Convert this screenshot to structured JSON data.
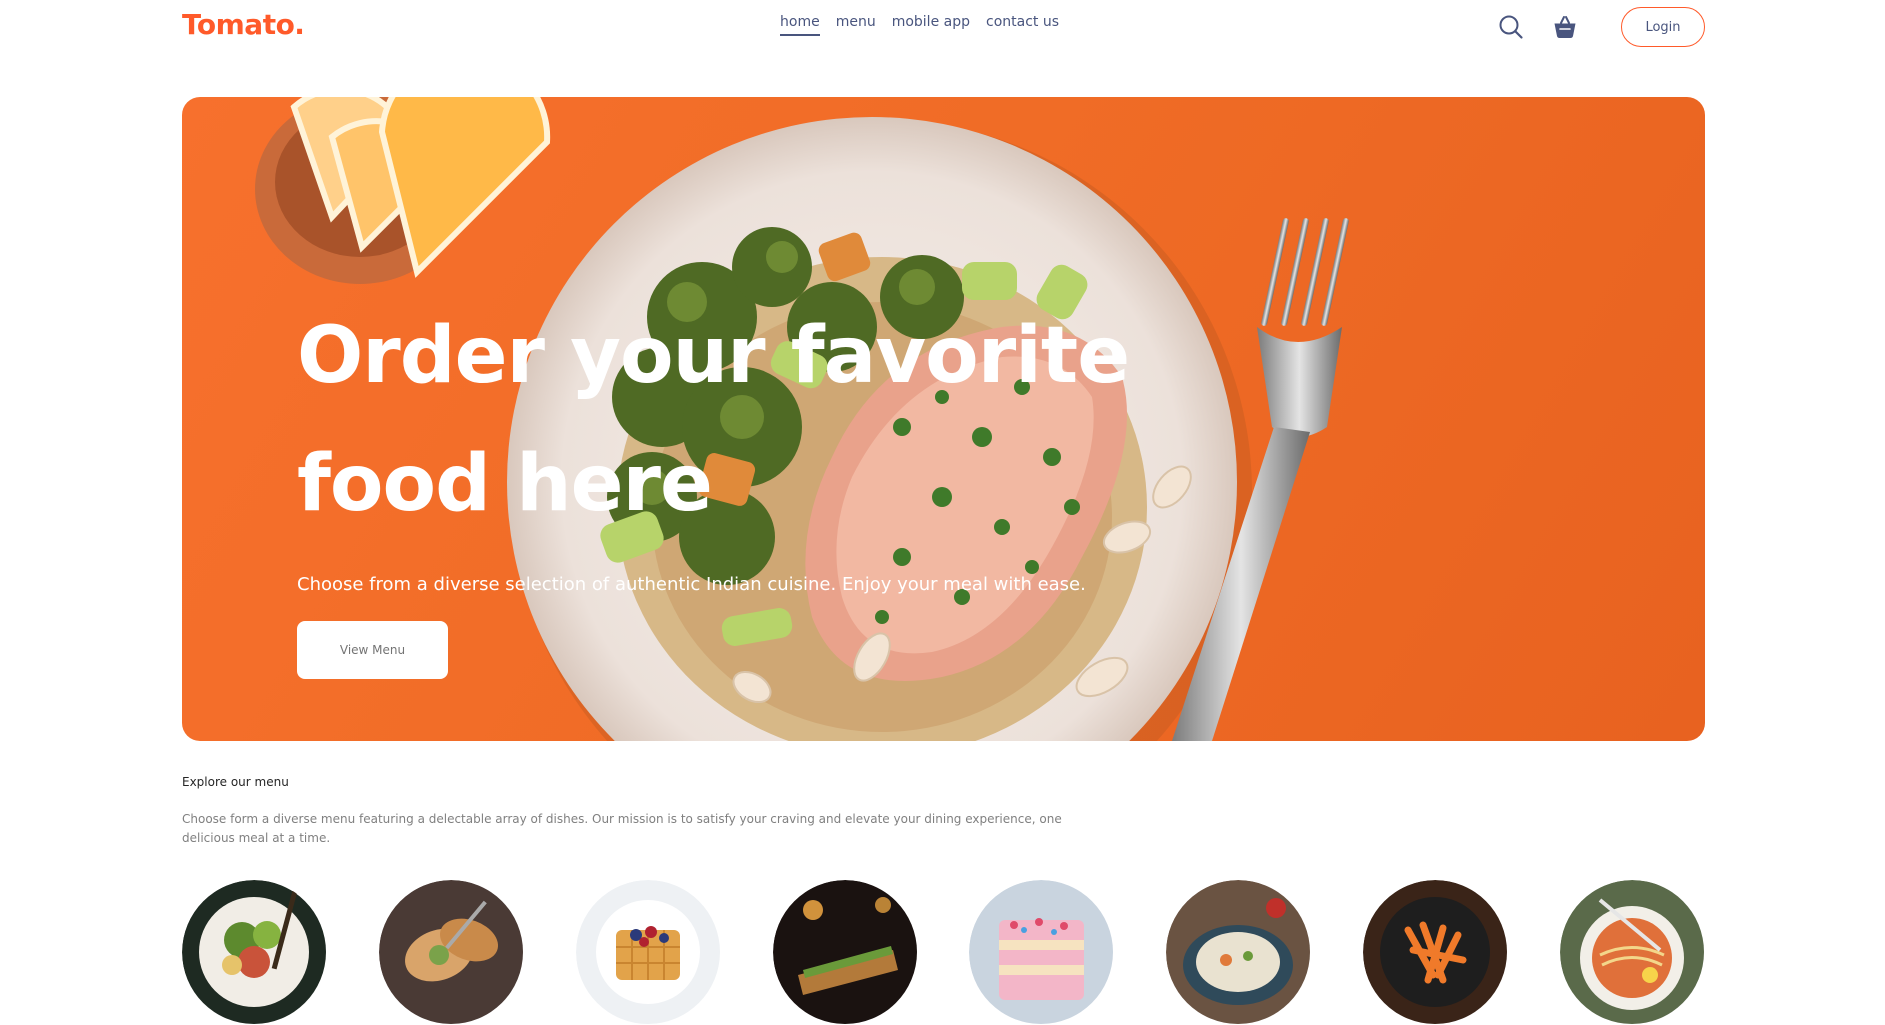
{
  "brand": {
    "name": "Tomato.",
    "color": "#ff5a2a"
  },
  "nav": {
    "links": [
      {
        "label": "home",
        "active": true
      },
      {
        "label": "menu",
        "active": false
      },
      {
        "label": "mobile app",
        "active": false
      },
      {
        "label": "contact us",
        "active": false
      }
    ],
    "search_icon": "search-icon",
    "basket_icon": "basket-icon",
    "login_label": "Login"
  },
  "hero": {
    "title_line1": "Order your favorite",
    "title_line2": "food here",
    "subtitle": "Choose from a diverse selection of authentic Indian cuisine. Enjoy your meal with ease.",
    "button_label": "View Menu",
    "background_color": "#f06c26"
  },
  "explore": {
    "title": "Explore our menu",
    "text": "Choose form a diverse menu featuring a delectable array of dishes. Our mission is to satisfy your craving and elevate your dining experience, one delicious meal at a time.",
    "items": [
      {
        "icon": "salad-image"
      },
      {
        "icon": "rolls-image"
      },
      {
        "icon": "dessert-image"
      },
      {
        "icon": "sandwich-image"
      },
      {
        "icon": "cake-image"
      },
      {
        "icon": "pure-veg-image"
      },
      {
        "icon": "pasta-image"
      },
      {
        "icon": "noodles-image"
      }
    ]
  }
}
